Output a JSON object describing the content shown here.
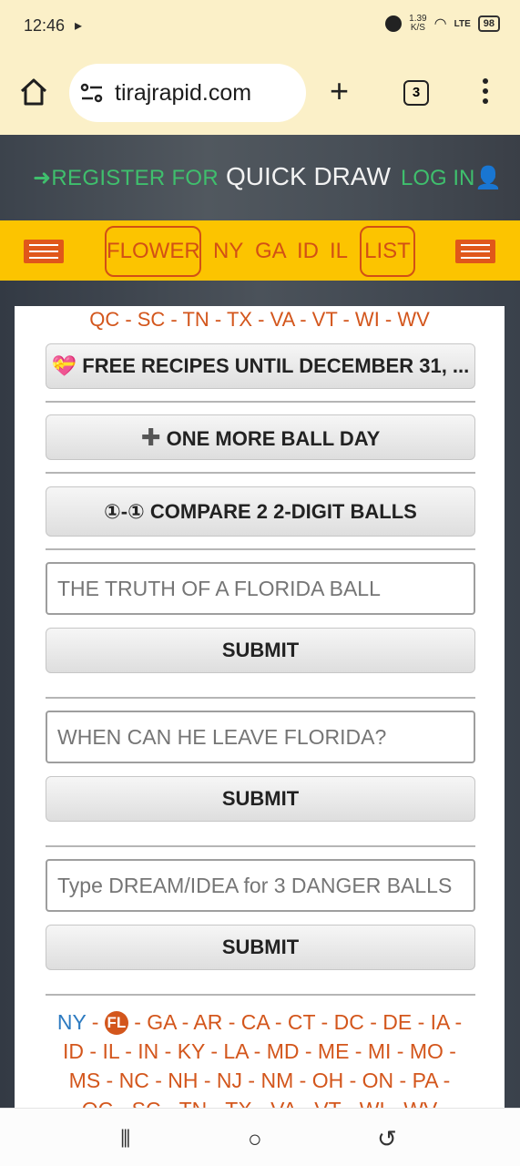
{
  "status_bar": {
    "time": "12:46",
    "net_speed_top": "1.39",
    "net_speed_bottom": "K/S",
    "network": "LTE",
    "battery": "98"
  },
  "browser": {
    "url": "tirajrapid.com",
    "tab_count": "3"
  },
  "site_header": {
    "register": "REGISTER FOR",
    "title": "QUICK DRAW",
    "login": "LOG IN"
  },
  "nav": {
    "flower": "FLOWER",
    "items": [
      "NY",
      "GA",
      "ID",
      "IL"
    ],
    "list": "LIST"
  },
  "states_top": "QC - SC - TN - TX - VA - VT - WI - WV",
  "buttons": {
    "free_recipes": "FREE RECIPES UNTIL DECEMBER 31, ...",
    "one_more": "ONE MORE BALL DAY",
    "compare": "①-① COMPARE 2 2-DIGIT BALLS",
    "submit": "SUBMIT"
  },
  "inputs": {
    "truth_placeholder": "THE TRUTH OF A FLORIDA BALL",
    "leave_placeholder": "WHEN CAN HE LEAVE FLORIDA?",
    "dream_placeholder": "Type DREAM/IDEA for 3 DANGER BALLS"
  },
  "states_bottom": {
    "ny": "NY",
    "fl": "FL",
    "line1_rest": " - GA - AR - CA - CT - DC - DE - IA -",
    "line2": "ID - IL - IN - KY - LA - MD - ME - MI - MO -",
    "line3": "MS - NC - NH - NJ - NM - OH - ON - PA -",
    "line4": "QC - SC - TN - TX - VA - VT - WI - WV"
  },
  "colors": {
    "accent": "#d3561c",
    "nav_bg": "#fcc400",
    "green": "#3fbf6d",
    "link_blue": "#2c7ac0"
  }
}
